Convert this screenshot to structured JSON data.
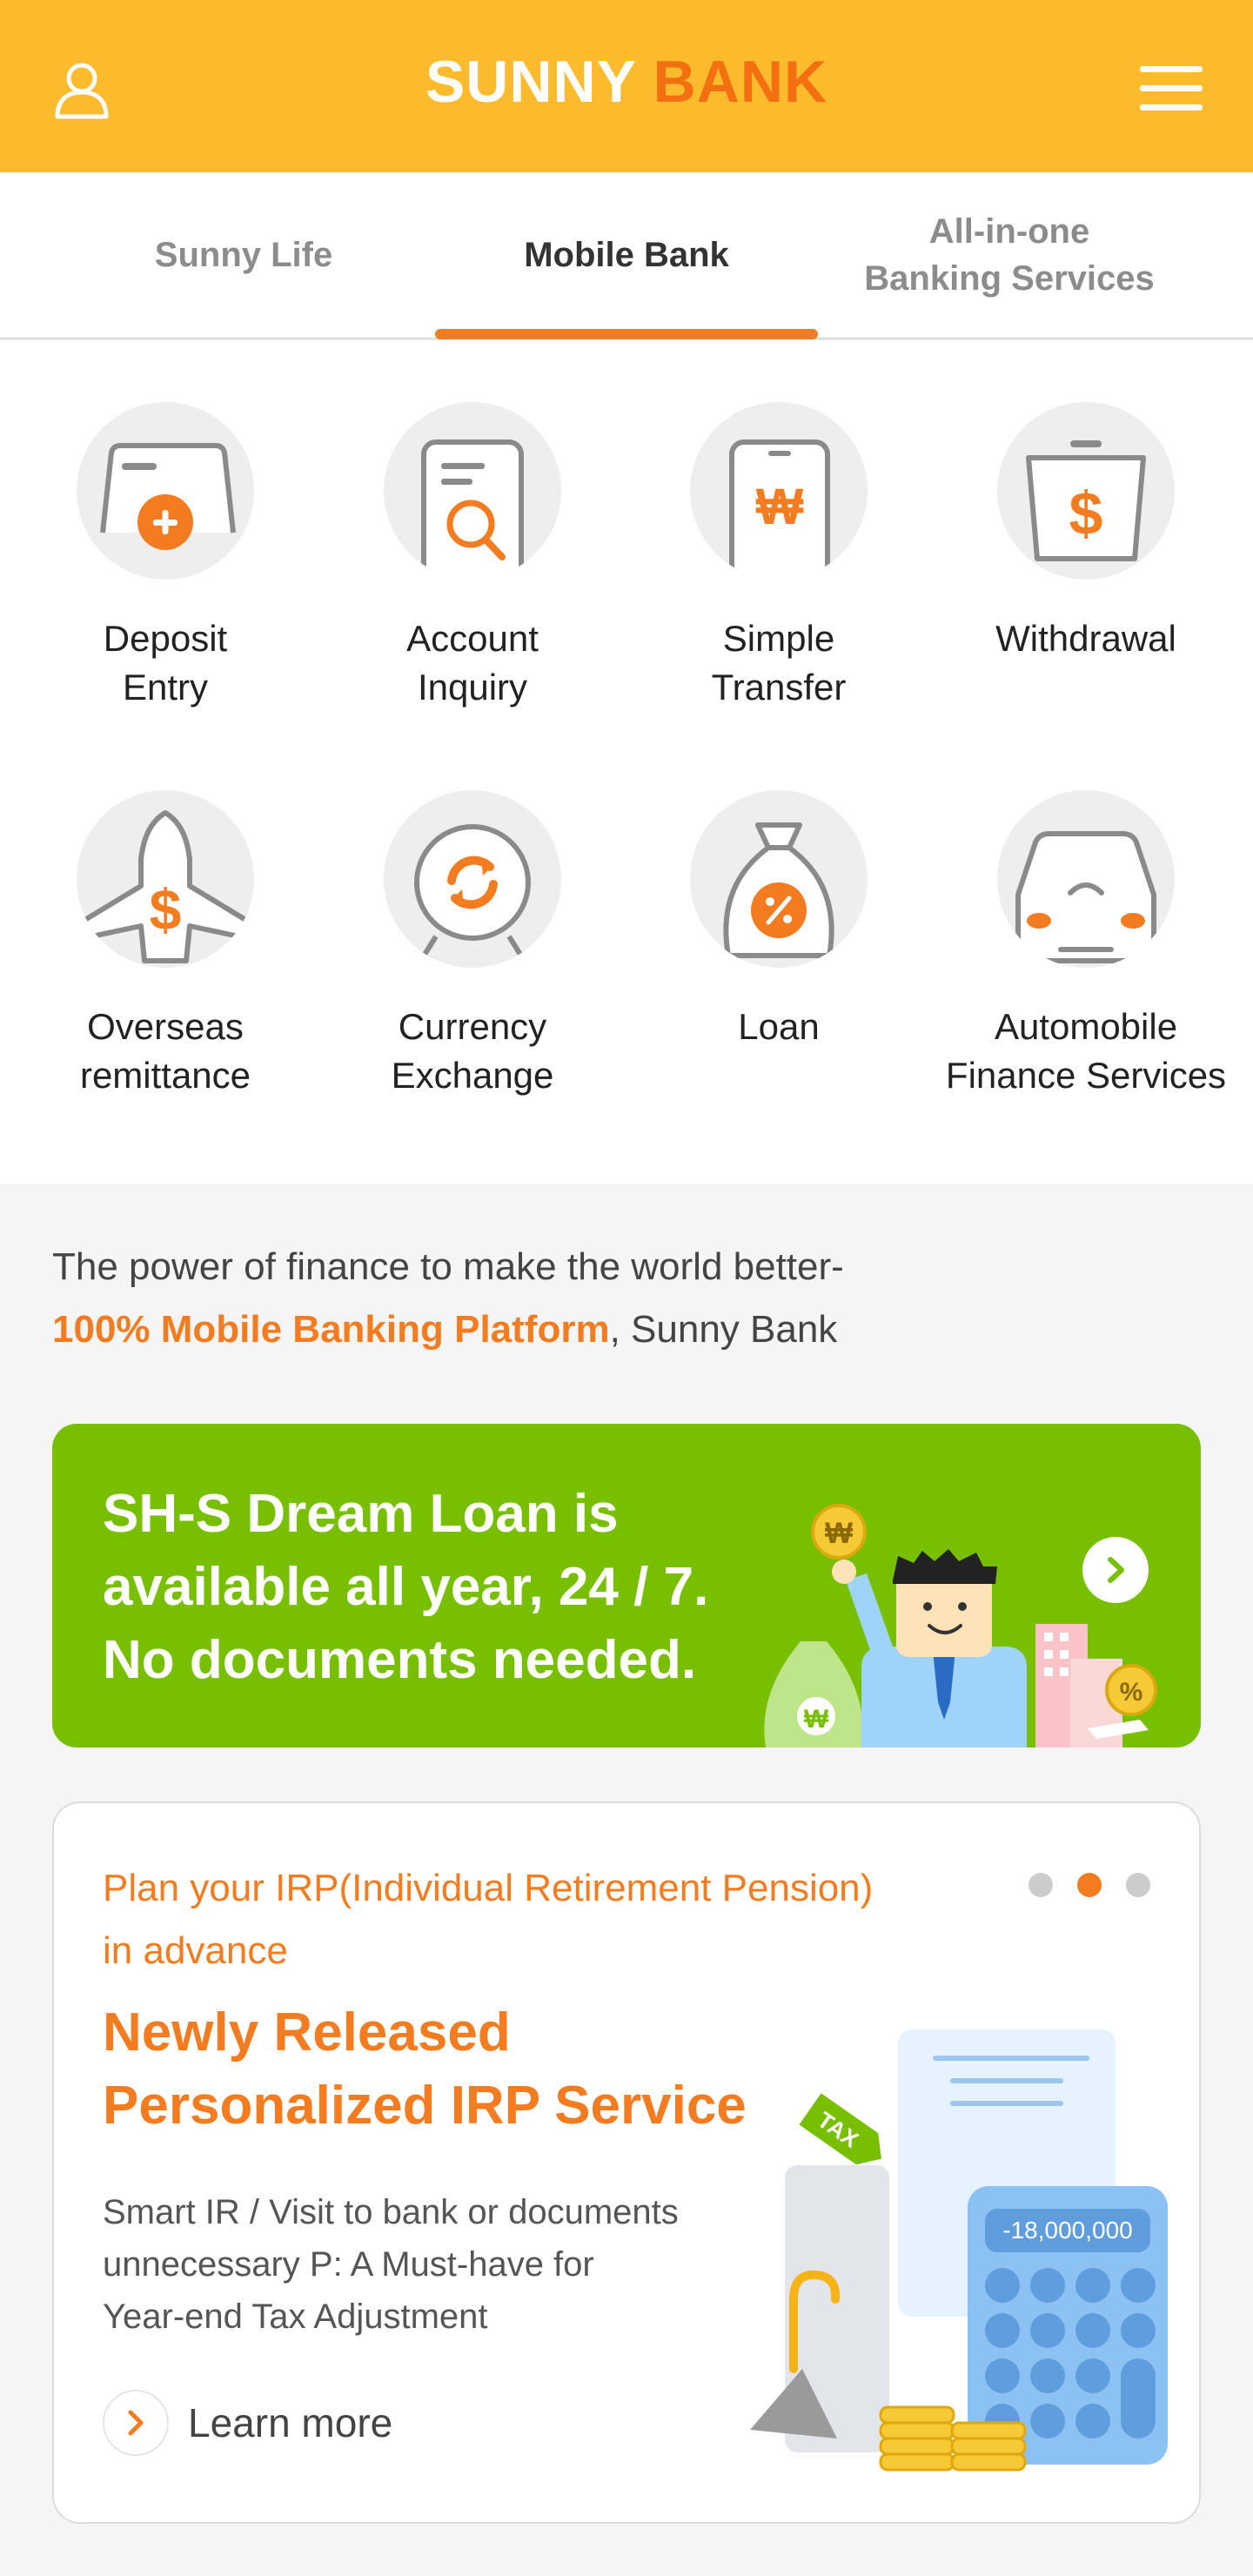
{
  "header": {
    "logo_part1": "SUNNY",
    "logo_part2": "BANK",
    "user_icon": "user-icon",
    "menu_icon": "hamburger-menu-icon"
  },
  "tabs": [
    {
      "label": "Sunny Life",
      "active": false
    },
    {
      "label": "Mobile Bank",
      "active": true
    },
    {
      "label": "All-in-one\nBanking Services",
      "active": false
    }
  ],
  "services": [
    {
      "label": "Deposit\nEntry",
      "icon": "deposit-entry-icon"
    },
    {
      "label": "Account\nInquiry",
      "icon": "account-inquiry-icon"
    },
    {
      "label": "Simple\nTransfer",
      "icon": "simple-transfer-icon"
    },
    {
      "label": "Withdrawal",
      "icon": "withdrawal-icon"
    },
    {
      "label": "Overseas\nremittance",
      "icon": "overseas-remittance-icon"
    },
    {
      "label": "Currency\nExchange",
      "icon": "currency-exchange-icon"
    },
    {
      "label": "Loan",
      "icon": "loan-icon"
    },
    {
      "label": "Automobile\nFinance Services",
      "icon": "automobile-finance-icon"
    }
  ],
  "tagline": {
    "line1": "The power of finance to make the world better-",
    "highlight": "100% Mobile Banking Platform",
    "suffix": ", Sunny Bank"
  },
  "banner": {
    "text": "SH-S Dream Loan is\navailable all year, 24 / 7.\nNo documents needed.",
    "arrow_icon": "chevron-right-icon"
  },
  "irp_card": {
    "subtitle": "Plan your IRP(Individual Retirement Pension)\nin advance",
    "title": "Newly Released\nPersonalized IRP Service",
    "description": "Smart IR / Visit to bank or documents\nunnecessary P: A Must-have for\nYear-end Tax Adjustment",
    "learn_more": "Learn more",
    "calculator_value": "-18,000,000",
    "tax_tag": "TAX",
    "pagination_active": 2,
    "pagination_total": 3
  },
  "colors": {
    "header_bg": "#fbbb2d",
    "accent": "#f47c20",
    "banner_bg": "#77bf00"
  }
}
